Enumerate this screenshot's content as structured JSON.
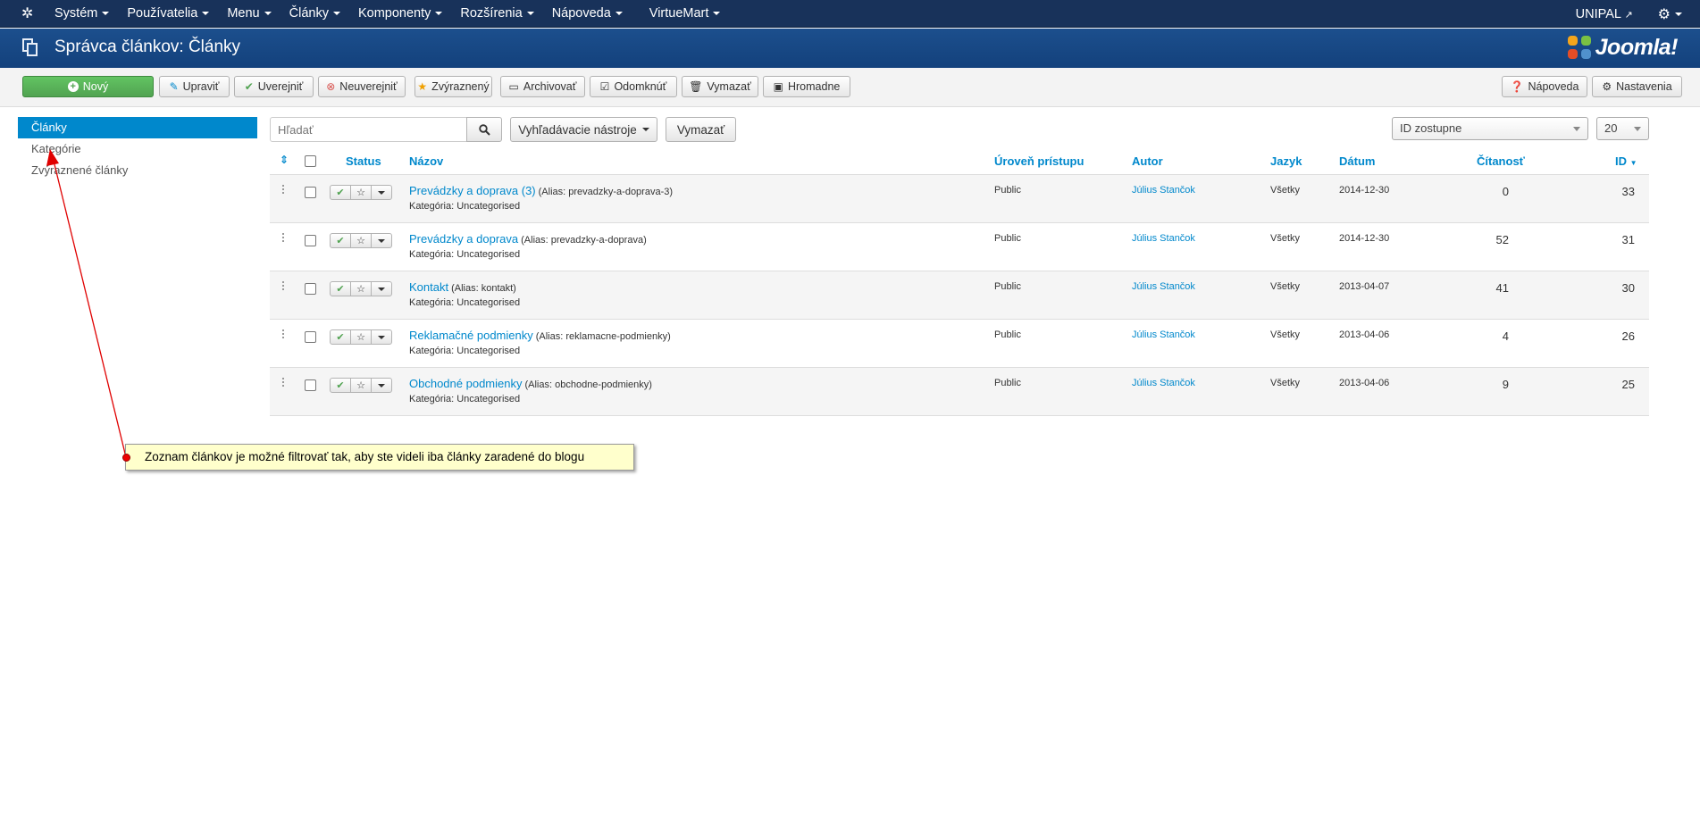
{
  "navbar": {
    "menu": [
      "Systém",
      "Používatelia",
      "Menu",
      "Články",
      "Komponenty",
      "Rozšírenia",
      "Nápoveda",
      "VirtueMart"
    ],
    "site": "UNIPAL"
  },
  "header": {
    "title": "Správca článkov: Články",
    "brand": "Joomla!"
  },
  "toolbar": {
    "new": "Nový",
    "edit": "Upraviť",
    "publish": "Uverejniť",
    "unpublish": "Neuverejniť",
    "featured": "Zvýraznený",
    "archive": "Archivovať",
    "checkin": "Odomknúť",
    "trash": "Vymazať",
    "batch": "Hromadne",
    "help": "Nápoveda",
    "options": "Nastavenia"
  },
  "sidebar": {
    "items": [
      "Články",
      "Kategórie",
      "Zvýraznené články"
    ]
  },
  "filters": {
    "search_placeholder": "Hľadať",
    "tools": "Vyhľadávacie nástroje",
    "clear": "Vymazať",
    "ordering": "ID zostupne",
    "limit": "20"
  },
  "table": {
    "headers": {
      "status": "Status",
      "title": "Názov",
      "access": "Úroveň prístupu",
      "author": "Autor",
      "language": "Jazyk",
      "date": "Dátum",
      "hits": "Čítanosť",
      "id": "ID"
    },
    "rows": [
      {
        "title": "Prevádzky a doprava (3)",
        "alias": "(Alias: prevadzky-a-doprava-3)",
        "category": "Kategória: Uncategorised",
        "access": "Public",
        "author": "Július Stančok",
        "language": "Všetky",
        "date": "2014-12-30",
        "hits": "0",
        "id": "33"
      },
      {
        "title": "Prevádzky a doprava",
        "alias": "(Alias: prevadzky-a-doprava)",
        "category": "Kategória: Uncategorised",
        "access": "Public",
        "author": "Július Stančok",
        "language": "Všetky",
        "date": "2014-12-30",
        "hits": "52",
        "id": "31"
      },
      {
        "title": "Kontakt",
        "alias": "(Alias: kontakt)",
        "category": "Kategória: Uncategorised",
        "access": "Public",
        "author": "Július Stančok",
        "language": "Všetky",
        "date": "2013-04-07",
        "hits": "41",
        "id": "30"
      },
      {
        "title": "Reklamačné podmienky",
        "alias": "(Alias: reklamacne-podmienky)",
        "category": "Kategória: Uncategorised",
        "access": "Public",
        "author": "Július Stančok",
        "language": "Všetky",
        "date": "2013-04-06",
        "hits": "4",
        "id": "26"
      },
      {
        "title": "Obchodné podmienky",
        "alias": "(Alias: obchodne-podmienky)",
        "category": "Kategória: Uncategorised",
        "access": "Public",
        "author": "Július Stančok",
        "language": "Všetky",
        "date": "2013-04-06",
        "hits": "9",
        "id": "25"
      }
    ]
  },
  "annotation": {
    "text": "Zoznam článkov je možné filtrovať tak, aby ste videli iba články zaradené do blogu"
  },
  "colors": {
    "navbar": "#18325a",
    "titlebar": "#1c4f8d",
    "accent": "#0088cc",
    "success": "#51a351",
    "callout": "#ffffcc",
    "arrow": "#e00000"
  }
}
